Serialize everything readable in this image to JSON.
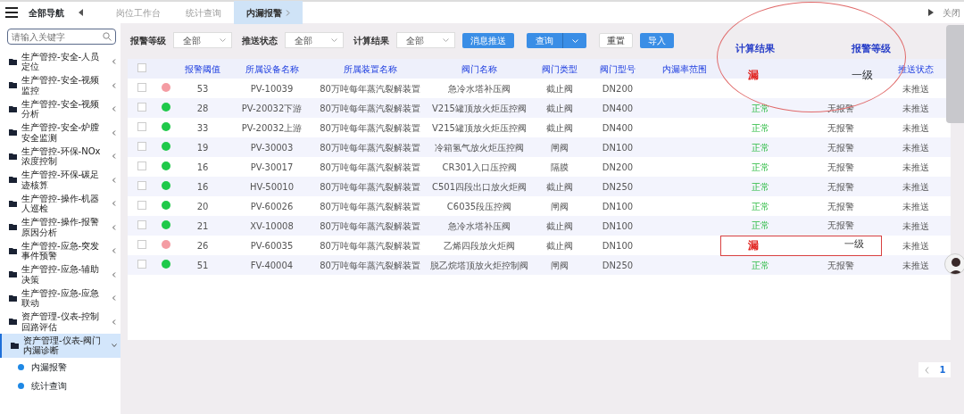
{
  "header": {
    "nav_title": "全部导航",
    "tabs": [
      {
        "label": "岗位工作台",
        "selected": false
      },
      {
        "label": "统计查询",
        "selected": false
      },
      {
        "label": "内漏报警",
        "selected": true
      }
    ],
    "close_text": "关闭"
  },
  "sidebar": {
    "search_placeholder": "请输入关键字",
    "items": [
      {
        "label": "生产管控-安全-人员定位",
        "expanded": false
      },
      {
        "label": "生产管控-安全-视频监控",
        "expanded": false
      },
      {
        "label": "生产管控-安全-视频分析",
        "expanded": false
      },
      {
        "label": "生产管控-安全-炉膛安全监测",
        "expanded": false
      },
      {
        "label": "生产管控-环保-NOx浓度控制",
        "expanded": false
      },
      {
        "label": "生产管控-环保-碳足迹核算",
        "expanded": false
      },
      {
        "label": "生产管控-操作-机器人巡检",
        "expanded": false
      },
      {
        "label": "生产管控-操作-报警原因分析",
        "expanded": false
      },
      {
        "label": "生产管控-应急-突发事件预警",
        "expanded": false
      },
      {
        "label": "生产管控-应急-辅助决策",
        "expanded": false
      },
      {
        "label": "生产管控-应急-应急联动",
        "expanded": false
      },
      {
        "label": "资产管理-仪表-控制回路评估",
        "expanded": false
      },
      {
        "label": "资产管理-仪表-阀门内漏诊断",
        "expanded": true,
        "children": [
          {
            "label": "内漏报警"
          },
          {
            "label": "统计查询"
          }
        ]
      }
    ]
  },
  "filters": [
    {
      "label": "报警等级",
      "value": "全部"
    },
    {
      "label": "推送状态",
      "value": "全部"
    },
    {
      "label": "计算结果",
      "value": "全部"
    }
  ],
  "buttons": [
    {
      "label": "消息推送",
      "kind": "primary"
    },
    {
      "label": "查询",
      "kind": "split"
    },
    {
      "label": "重置",
      "kind": "plain"
    },
    {
      "label": "导入",
      "kind": "primary"
    }
  ],
  "table": {
    "select_all_checked": false,
    "columns": [
      "报警阈值",
      "所属设备名称",
      "所属装置名称",
      "阀门名称",
      "阀门类型",
      "阀门型号",
      "内漏率范围",
      "推送状态"
    ],
    "rows": [
      {
        "checked": false,
        "alarm": true,
        "cells": [
          "53",
          "PV-10039",
          "80万吨每年蒸汽裂解装置",
          "急冷水塔补压阀",
          "截止阀",
          "DN200",
          ""
        ],
        "push": "未推送"
      },
      {
        "checked": false,
        "alarm": false,
        "cells": [
          "28",
          "PV-20032下游",
          "80万吨每年蒸汽裂解装置",
          "V215罐顶放火炬压控阀",
          "截止阀",
          "DN400",
          ""
        ],
        "result": "正常",
        "level": "无报警",
        "push": "未推送"
      },
      {
        "checked": false,
        "alarm": false,
        "cells": [
          "33",
          "PV-20032上游",
          "80万吨每年蒸汽裂解装置",
          "V215罐顶放火炬压控阀",
          "截止阀",
          "DN400",
          ""
        ],
        "result": "正常",
        "level": "无报警",
        "push": "未推送"
      },
      {
        "checked": false,
        "alarm": false,
        "cells": [
          "19",
          "PV-30003",
          "80万吨每年蒸汽裂解装置",
          "冷箱氢气放火炬压控阀",
          "闸阀",
          "DN100",
          ""
        ],
        "result": "正常",
        "level": "无报警",
        "push": "未推送"
      },
      {
        "checked": false,
        "alarm": false,
        "cells": [
          "16",
          "PV-30017",
          "80万吨每年蒸汽裂解装置",
          "CR301入口压控阀",
          "隔膜",
          "DN200",
          ""
        ],
        "result": "正常",
        "level": "无报警",
        "push": "未推送"
      },
      {
        "checked": false,
        "alarm": false,
        "cells": [
          "16",
          "HV-50010",
          "80万吨每年蒸汽裂解装置",
          "C501四段出口放火炬阀",
          "截止阀",
          "DN250",
          ""
        ],
        "result": "正常",
        "level": "无报警",
        "push": "未推送"
      },
      {
        "checked": false,
        "alarm": false,
        "cells": [
          "20",
          "PV-60026",
          "80万吨每年蒸汽裂解装置",
          "C6035段压控阀",
          "闸阀",
          "DN100",
          ""
        ],
        "result": "正常",
        "level": "无报警",
        "push": "未推送"
      },
      {
        "checked": false,
        "alarm": false,
        "cells": [
          "21",
          "XV-10008",
          "80万吨每年蒸汽裂解装置",
          "急冷水塔补压阀",
          "截止阀",
          "DN100",
          ""
        ],
        "result": "正常",
        "level": "无报警",
        "push": "未推送"
      },
      {
        "checked": false,
        "alarm": true,
        "cells": [
          "26",
          "PV-60035",
          "80万吨每年蒸汽裂解装置",
          "乙烯四段放火炬阀",
          "截止阀",
          "DN100",
          ""
        ],
        "result": "漏",
        "level": "一级",
        "boxed": true,
        "push": "未推送"
      },
      {
        "checked": false,
        "alarm": false,
        "cells": [
          "51",
          "FV-40004",
          "80万吨每年蒸汽裂解装置",
          "脱乙烷塔顶放火炬控制阀",
          "闸阀",
          "DN250",
          ""
        ],
        "result": "正常",
        "level": "无报警",
        "push": "未推送"
      }
    ]
  },
  "callout": {
    "headers": [
      "计算结果",
      "报警等级"
    ],
    "values": [
      "漏",
      "一级"
    ]
  },
  "pagination": {
    "pages": [
      {
        "label": "1",
        "selected": true
      }
    ]
  }
}
